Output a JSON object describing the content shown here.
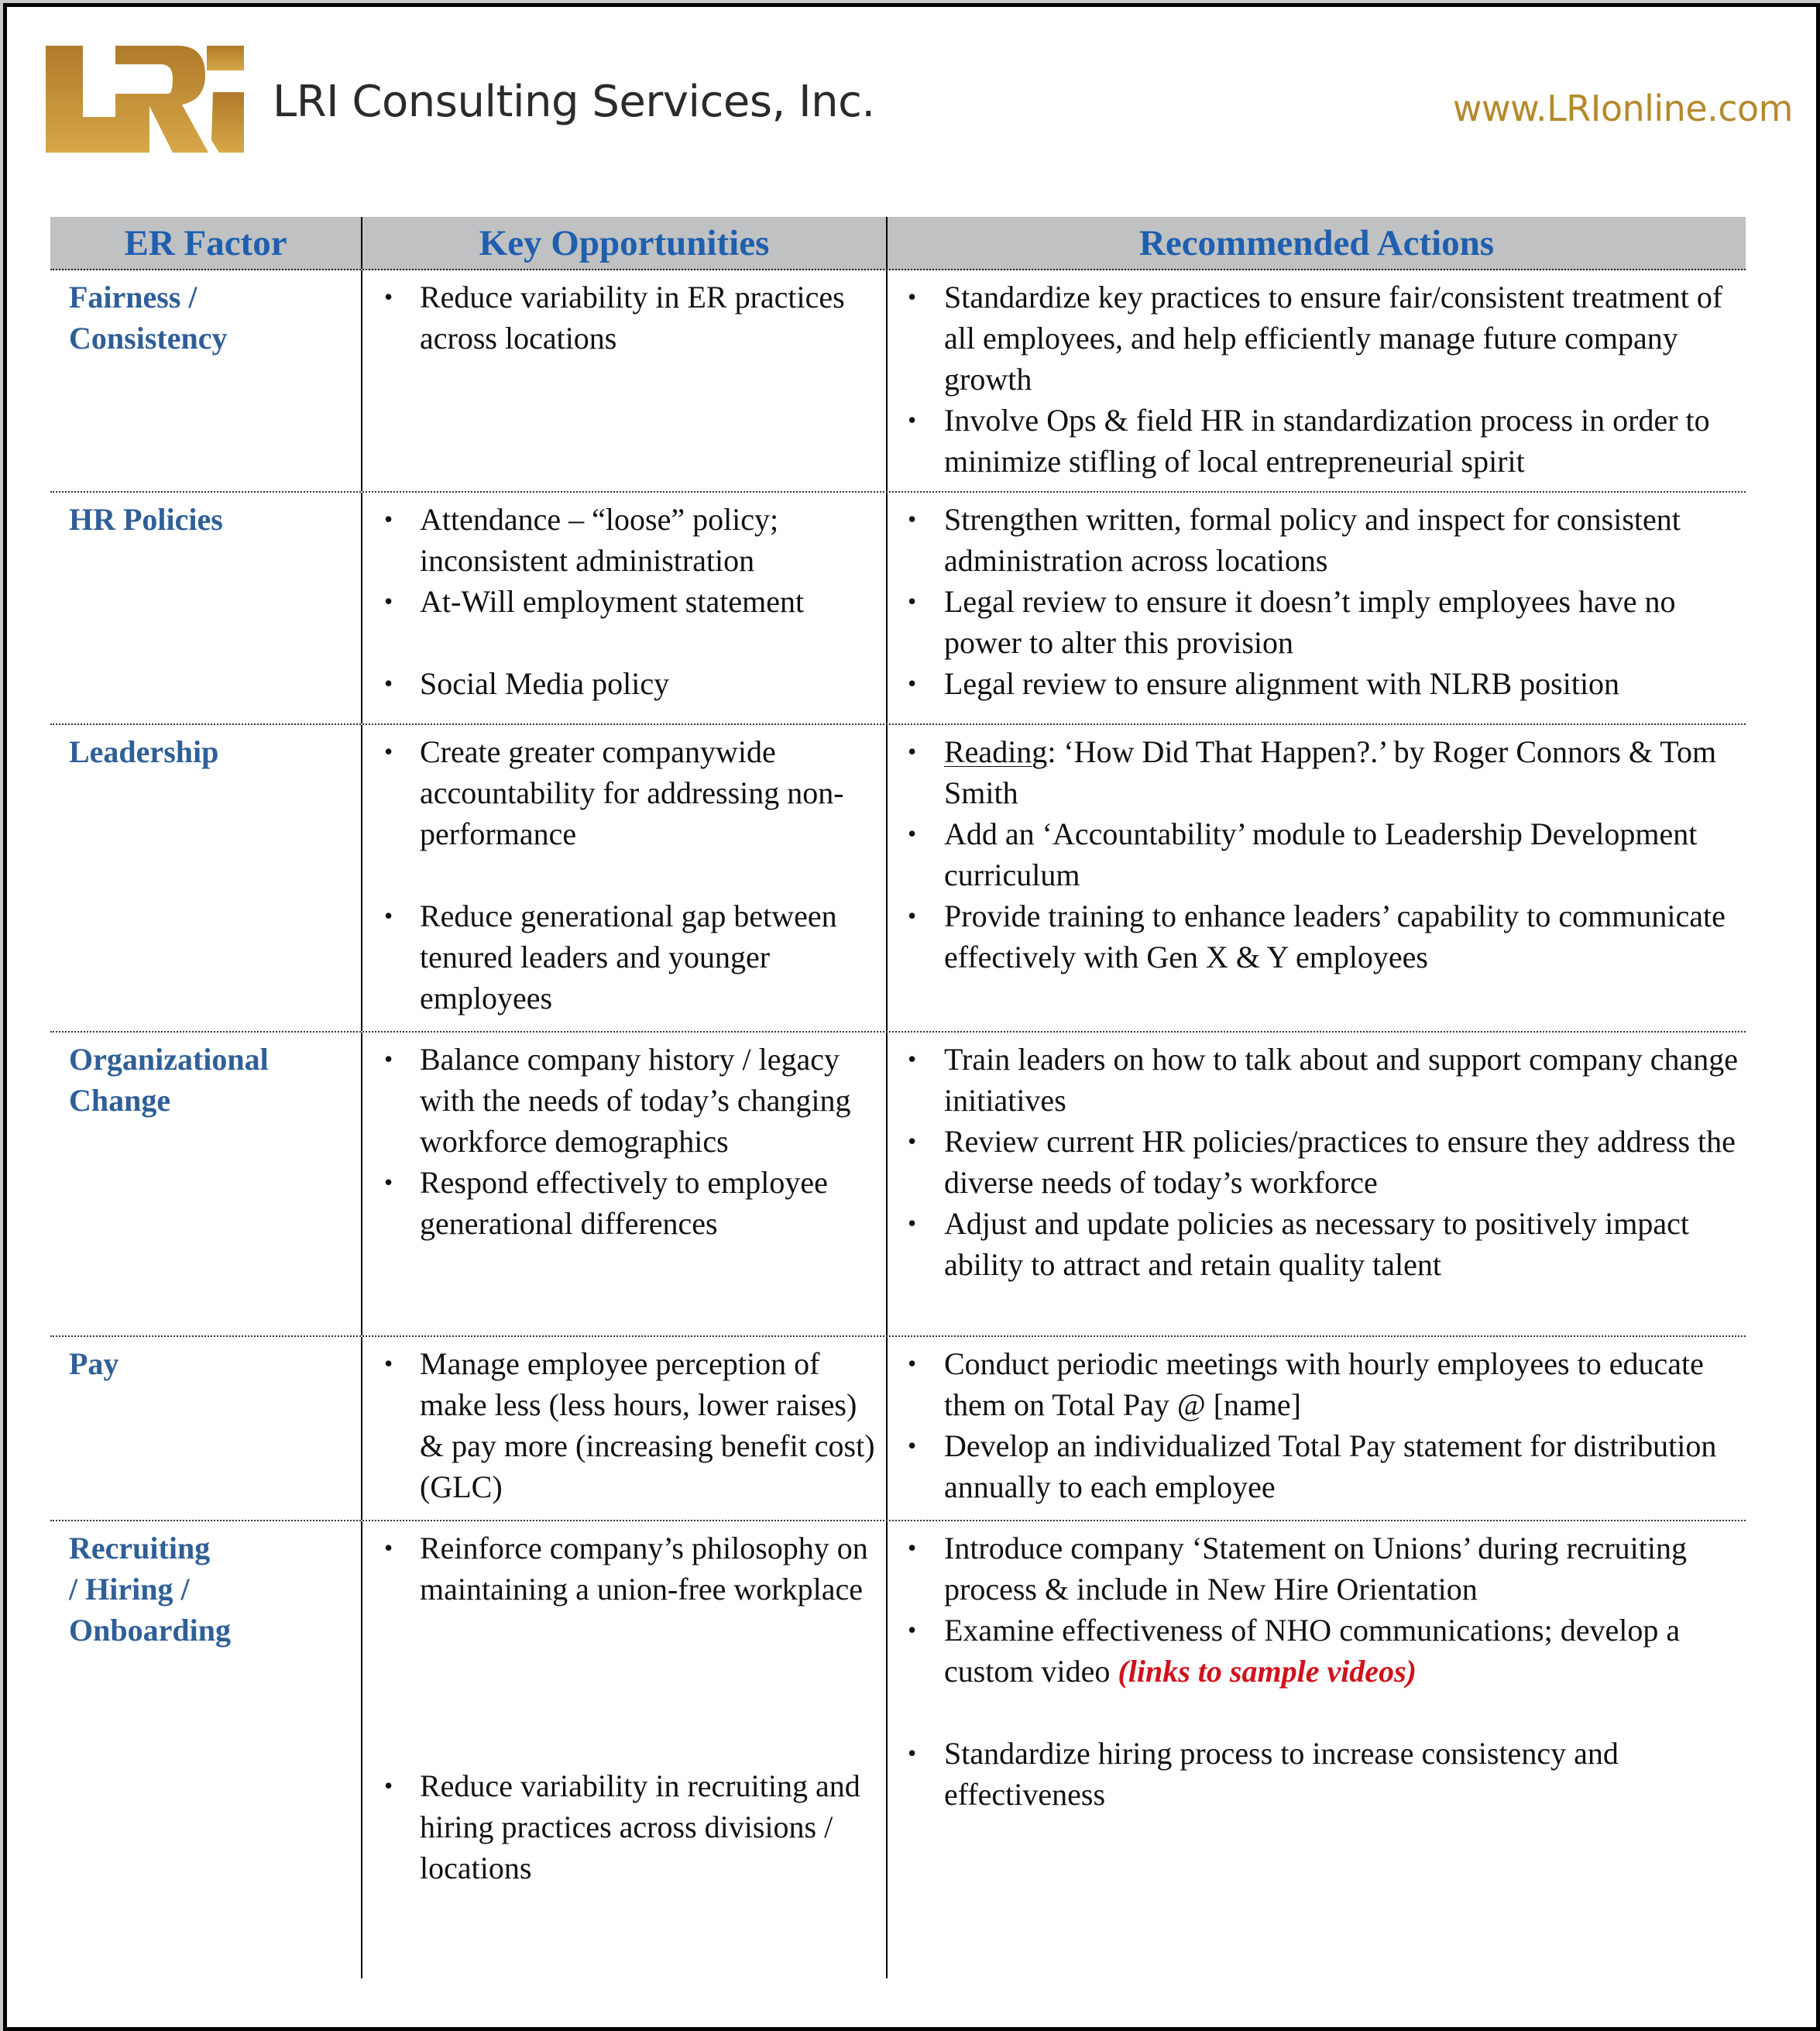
{
  "header": {
    "logo_text": "LRI",
    "company_name": "LRI Consulting Services, Inc.",
    "website": "www.LRIonline.com",
    "colors": {
      "gold": "#b48a2c",
      "header_blue": "#1f5fae",
      "factor_blue": "#2f5f97",
      "header_bg": "#bfc1c2",
      "link_red": "#d0121b"
    }
  },
  "table": {
    "columns": [
      "ER Factor",
      "Key Opportunities",
      "Recommended Actions"
    ],
    "rows": [
      {
        "factor": "Fairness / Consistency",
        "opportunities": [
          "Reduce variability in ER practices across locations"
        ],
        "actions": [
          "Standardize key practices to ensure fair/consistent treatment of all employees, and help efficiently manage future company growth",
          "Involve Ops & field HR in standardization process in order to minimize stifling of local entrepreneurial spirit"
        ]
      },
      {
        "factor": "HR Policies",
        "opportunities": [
          "Attendance – “loose” policy; inconsistent administration",
          "At-Will employment statement",
          "Social Media policy"
        ],
        "actions": [
          "Strengthen written, formal policy and inspect for consistent administration across locations",
          "Legal review to ensure it doesn’t imply employees have no power to alter this provision",
          "Legal review to ensure alignment with NLRB position"
        ]
      },
      {
        "factor": "Leadership",
        "opportunities": [
          "Create greater companywide accountability for addressing non-performance",
          "Reduce generational gap between tenured leaders and younger employees"
        ],
        "actions": [
          {
            "underlined": "Reading",
            "rest": ":  ‘How Did That Happen?.’ by Roger Connors & Tom Smith"
          },
          "Add an ‘Accountability’ module to Leadership Development curriculum",
          "Provide training to enhance leaders’ capability to communicate effectively with Gen X & Y employees"
        ]
      },
      {
        "factor": "Organizational Change",
        "opportunities": [
          "Balance company history / legacy with the needs of today’s changing workforce demographics",
          "Respond effectively to employee generational differences"
        ],
        "actions": [
          "Train leaders on how to talk about and support company change initiatives",
          "Review current HR policies/practices to ensure they address the diverse needs of today’s workforce",
          "Adjust and update policies as necessary to positively impact ability to attract and retain quality talent"
        ]
      },
      {
        "factor": "Pay",
        "opportunities": [
          "Manage employee perception of make less (less hours, lower raises) & pay more (increasing benefit cost) (GLC)"
        ],
        "actions": [
          "Conduct periodic meetings with hourly employees to educate them on Total Pay @ [name]",
          "Develop an individualized Total Pay statement for distribution annually to each employee"
        ]
      },
      {
        "factor": "Recruiting / Hiring / Onboarding",
        "opportunities": [
          "Reinforce company’s philosophy on maintaining a union-free workplace",
          "Reduce variability in recruiting and hiring practices across divisions / locations"
        ],
        "actions": [
          "Introduce company ‘Statement on Unions’ during recruiting process & include in New Hire Orientation",
          {
            "text": "Examine effectiveness of NHO communications; develop a custom video ",
            "link": "(links to sample videos)"
          },
          "Standardize hiring process to increase consistency and effectiveness"
        ]
      }
    ]
  }
}
